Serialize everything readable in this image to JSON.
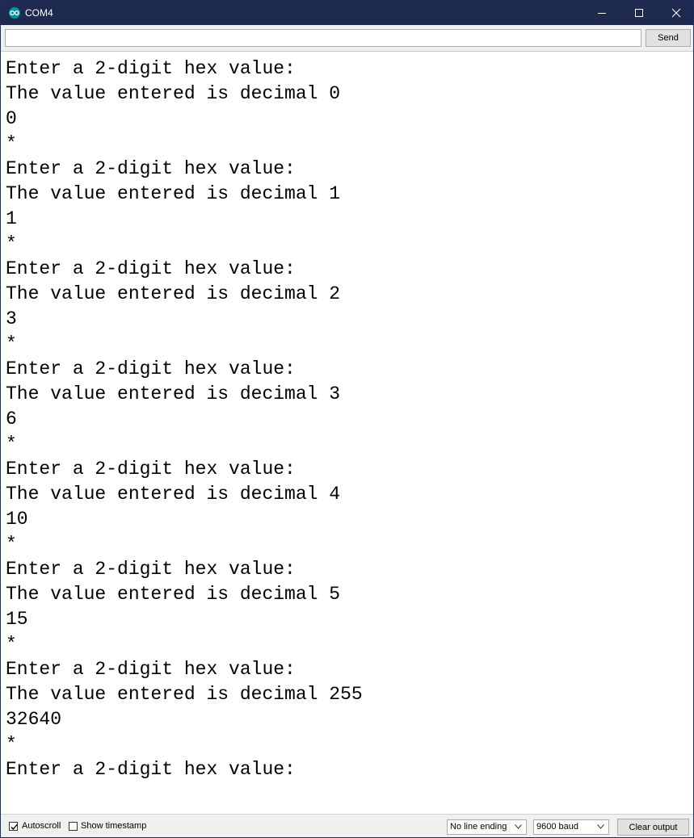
{
  "window": {
    "title": "COM4",
    "accent_color": "#1e2a4f",
    "icon": "arduino-infinity-icon"
  },
  "toolbar": {
    "input_value": "",
    "send_label": "Send"
  },
  "output": {
    "lines": [
      "Enter a 2-digit hex value:",
      "The value entered is decimal 0",
      "0",
      "*",
      "Enter a 2-digit hex value:",
      "The value entered is decimal 1",
      "1",
      "*",
      "Enter a 2-digit hex value:",
      "The value entered is decimal 2",
      "3",
      "*",
      "Enter a 2-digit hex value:",
      "The value entered is decimal 3",
      "6",
      "*",
      "Enter a 2-digit hex value:",
      "The value entered is decimal 4",
      "10",
      "*",
      "Enter a 2-digit hex value:",
      "The value entered is decimal 5",
      "15",
      "*",
      "Enter a 2-digit hex value:",
      "The value entered is decimal 255",
      "32640",
      "*",
      "Enter a 2-digit hex value:"
    ]
  },
  "statusbar": {
    "autoscroll_label": "Autoscroll",
    "autoscroll_checked": true,
    "timestamp_label": "Show timestamp",
    "timestamp_checked": false,
    "line_ending_selected": "No line ending",
    "baud_selected": "9600 baud",
    "clear_label": "Clear output"
  }
}
